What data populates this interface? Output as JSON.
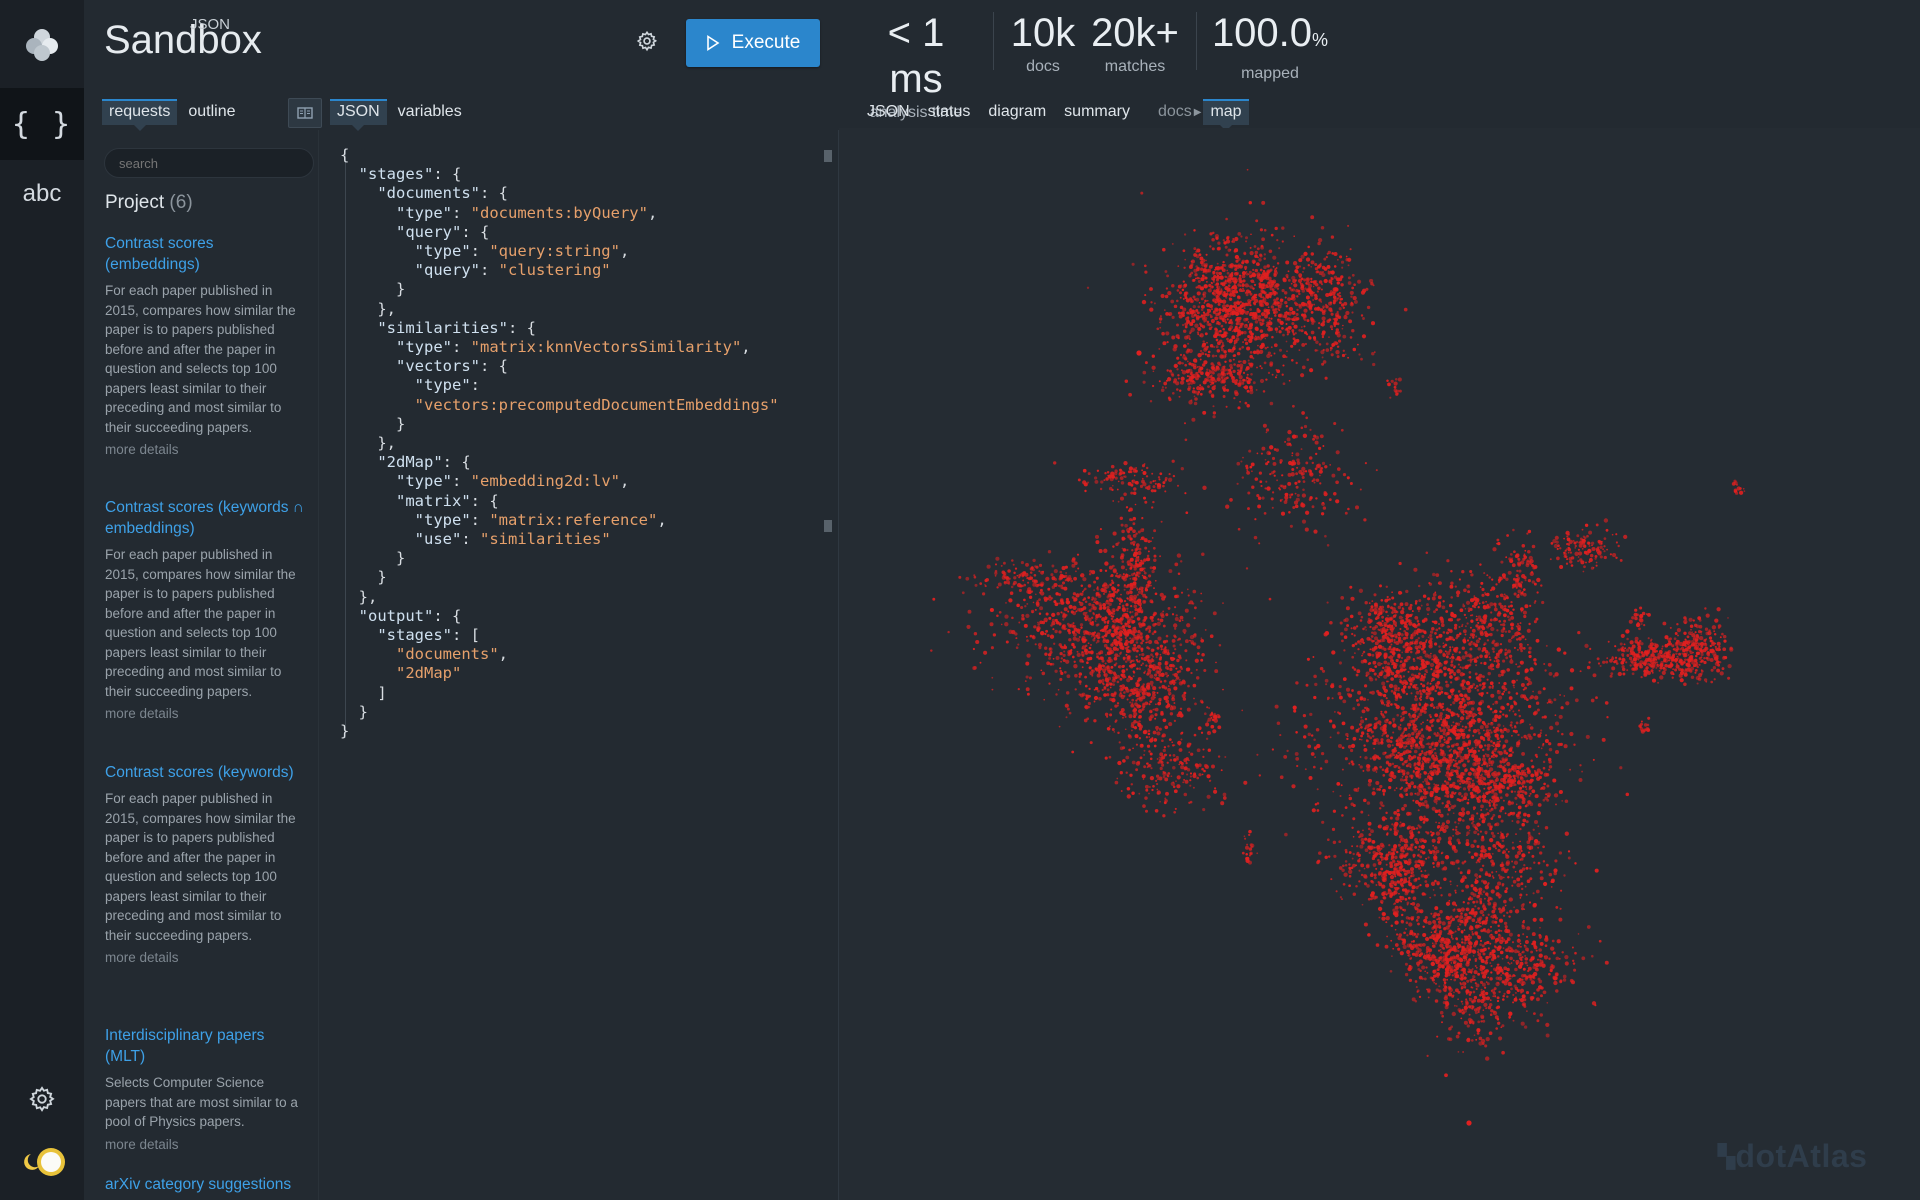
{
  "app": {
    "brand": "Sandbox",
    "brand_sup": "JSON",
    "execute_label": "Execute"
  },
  "stats": [
    {
      "value": "< 1 ms",
      "label": "analysis time"
    },
    {
      "value": "10k",
      "label": "docs"
    },
    {
      "value": "20k+",
      "label": "matches"
    },
    {
      "value": "100.0",
      "unit": "%",
      "label": "mapped"
    }
  ],
  "left_tabs": [
    "requests",
    "outline"
  ],
  "editor_tabs": [
    "JSON",
    "variables"
  ],
  "result_tabs": [
    "JSON",
    "status",
    "diagram",
    "summary"
  ],
  "result_crumb": "docs",
  "result_active": "map",
  "sidebar": {
    "rail_json": "{ }",
    "rail_abc": "abc",
    "search_placeholder": "search",
    "project_label": "Project",
    "project_count": "(6)",
    "requests": [
      {
        "title": "Contrast scores (embeddings)",
        "desc": "For each paper published in 2015, compares how similar the paper is to papers published before and after the paper in question and selects top 100 papers least similar to their preceding and most similar to their succeeding papers.",
        "more": "more details"
      },
      {
        "title": "Contrast scores (keywords ∩ embeddings)",
        "desc": "For each paper published in 2015, compares how similar the paper is to papers published before and after the paper in question and selects top 100 papers least similar to their preceding and most similar to their succeeding papers.",
        "more": "more details"
      },
      {
        "title": "Contrast scores (keywords)",
        "desc": "For each paper published in 2015, compares how similar the paper is to papers published before and after the paper in question and selects top 100 papers least similar to their preceding and most similar to their succeeding papers.",
        "more": "more details"
      },
      {
        "title": "Interdisciplinary papers (MLT)",
        "desc": "Selects Computer Science papers that are most similar to a pool of Physics papers.",
        "more": "more details"
      },
      {
        "title": "arXiv category suggestions",
        "desc": "",
        "more": ""
      }
    ]
  },
  "editor": {
    "code": "{\n  \"stages\": {\n    \"documents\": {\n      \"type\": \"documents:byQuery\",\n      \"query\": {\n        \"type\": \"query:string\",\n        \"query\": \"clustering\"\n      }\n    },\n    \"similarities\": {\n      \"type\": \"matrix:knnVectorsSimilarity\",\n      \"vectors\": {\n        \"type\":\n        \"vectors:precomputedDocumentEmbeddings\"\n      }\n    },\n    \"2dMap\": {\n      \"type\": \"embedding2d:lv\",\n      \"matrix\": {\n        \"type\": \"matrix:reference\",\n        \"use\": \"similarities\"\n      }\n    }\n  },\n  \"output\": {\n    \"stages\": [\n      \"documents\",\n      \"2dMap\"\n    ]\n  }\n}"
  },
  "map": {
    "point_color": "#e02020",
    "watermark": "dotAtlas"
  }
}
